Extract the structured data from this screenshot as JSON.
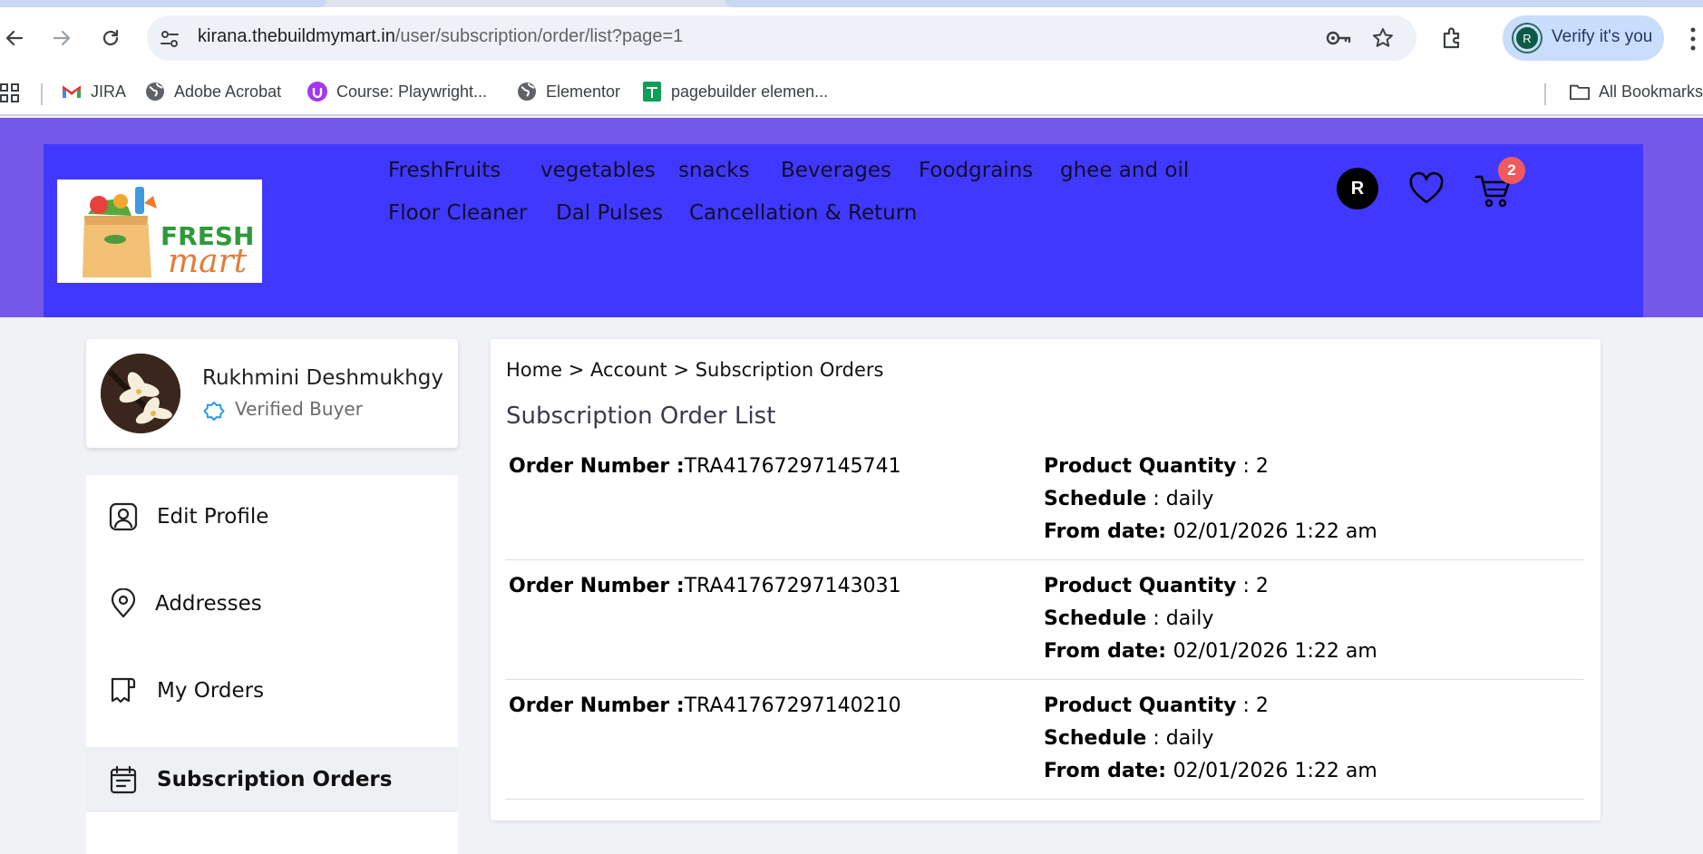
{
  "browser": {
    "url_host": "kirana.thebuildmymart.in",
    "url_path": "/user/subscription/order/list?page=1",
    "verify_label": "Verify it's you",
    "profile_initial": "R",
    "bookmarks": [
      {
        "label": "JIRA",
        "icon": "gmail-icon"
      },
      {
        "label": "Adobe Acrobat",
        "icon": "globe-icon"
      },
      {
        "label": "Course: Playwright...",
        "icon": "udemy-icon"
      },
      {
        "label": "Elementor",
        "icon": "globe-icon"
      },
      {
        "label": "pagebuilder elemen...",
        "icon": "sheets-icon"
      }
    ],
    "all_bookmarks_label": "All Bookmarks"
  },
  "header": {
    "logo_fresh": "FRESH",
    "logo_mart": "mart",
    "nav": [
      {
        "label": "FreshFruits"
      },
      {
        "label": "vegetables"
      },
      {
        "label": "snacks"
      },
      {
        "label": "Beverages"
      },
      {
        "label": "Foodgrains"
      },
      {
        "label": "ghee and oil"
      },
      {
        "label": "Floor Cleaner"
      },
      {
        "label": "Dal Pulses"
      },
      {
        "label": "Cancellation & Return"
      }
    ],
    "user_initial": "R",
    "cart_count": "2",
    "colors": {
      "outer": "#7458e8",
      "inner": "#4138ff",
      "badge": "#ef5b5b"
    }
  },
  "sidebar": {
    "user_name": "Rukhmini Deshmukhgy",
    "verified_label": "Verified Buyer",
    "items": [
      {
        "label": "Edit Profile",
        "icon": "user-profile-icon"
      },
      {
        "label": "Addresses",
        "icon": "location-pin-icon"
      },
      {
        "label": "My Orders",
        "icon": "receipt-icon"
      },
      {
        "label": "Subscription Orders",
        "icon": "calendar-icon",
        "active": true
      }
    ]
  },
  "main": {
    "breadcrumb": {
      "home": "Home",
      "sep1": " > ",
      "account": "Account",
      "sep2": " > ",
      "current": "Subscription Orders"
    },
    "title": "Subscription Order List",
    "labels": {
      "order_number": "Order Number",
      "product_quantity": "Product Quantity",
      "schedule": "Schedule",
      "from_date": "From date"
    },
    "orders": [
      {
        "order_number": "TRA41767297145741",
        "quantity": "2",
        "schedule": "daily",
        "from_date": "02/01/2026 1:22 am"
      },
      {
        "order_number": "TRA41767297143031",
        "quantity": "2",
        "schedule": "daily",
        "from_date": "02/01/2026 1:22 am"
      },
      {
        "order_number": "TRA41767297140210",
        "quantity": "2",
        "schedule": "daily",
        "from_date": "02/01/2026 1:22 am"
      }
    ]
  }
}
